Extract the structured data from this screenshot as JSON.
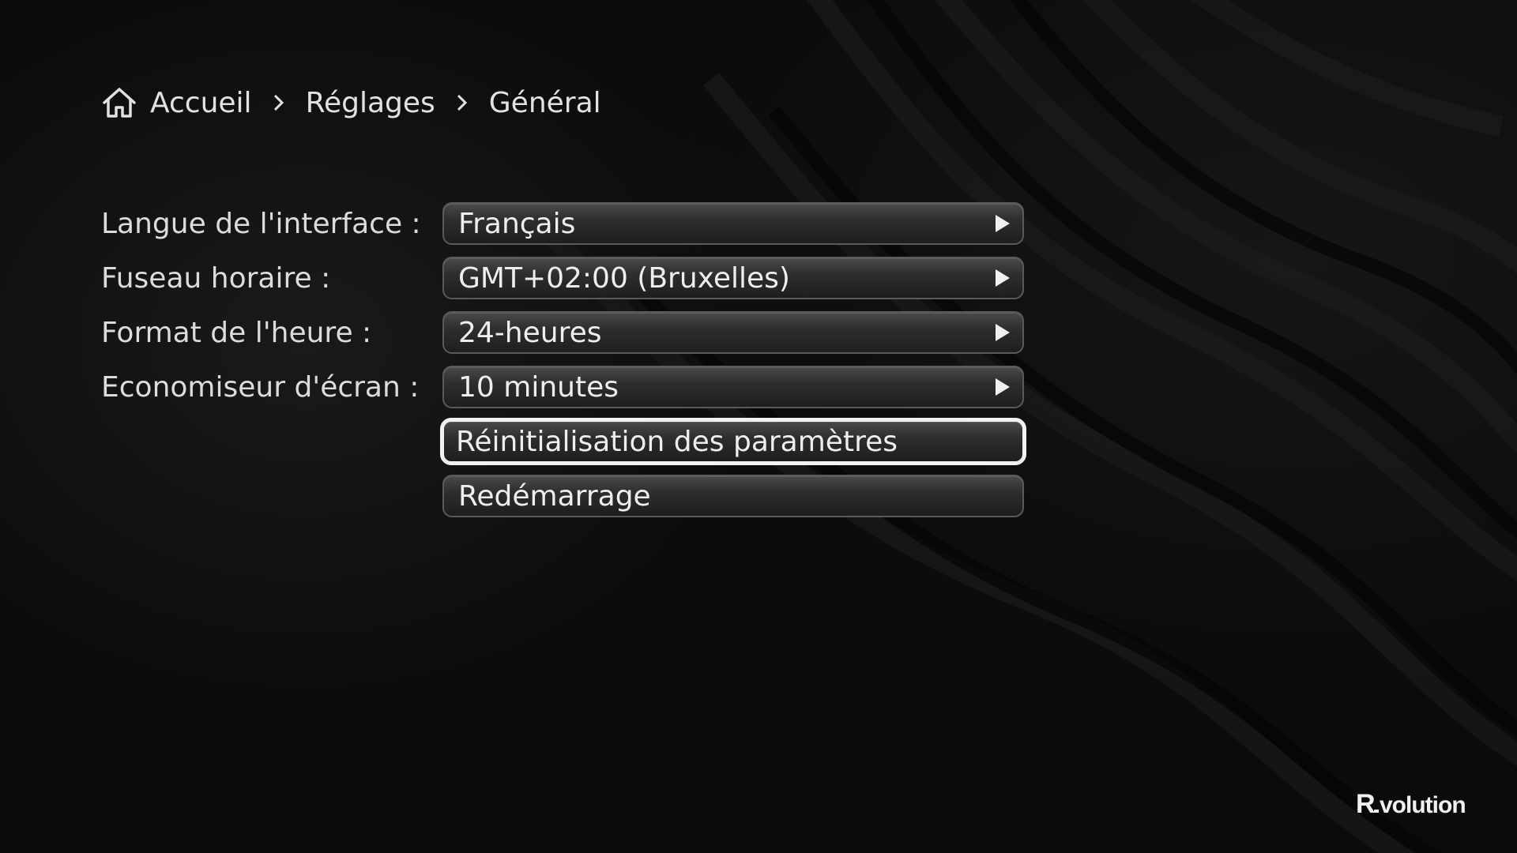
{
  "breadcrumb": {
    "home_icon": "home-icon",
    "separator_icon": "chevron-right-icon",
    "items": [
      "Accueil",
      "Réglages",
      "Général"
    ]
  },
  "settings": {
    "rows": [
      {
        "label": "Langue de l'interface :",
        "value": "Français",
        "icon": "play-arrow-icon"
      },
      {
        "label": "Fuseau horaire :",
        "value": "GMT+02:00 (Bruxelles)",
        "icon": "play-arrow-icon"
      },
      {
        "label": "Format de l'heure :",
        "value": "24-heures",
        "icon": "play-arrow-icon"
      },
      {
        "label": "Economiseur d'écran :",
        "value": "10 minutes",
        "icon": "play-arrow-icon"
      }
    ],
    "actions": [
      {
        "label": "Réinitialisation des paramètres",
        "focused": true
      },
      {
        "label": "Redémarrage",
        "focused": false
      }
    ]
  },
  "brand": {
    "logo_text": "R_volution"
  },
  "colors": {
    "background": "#0b0b0b",
    "text": "#e6e6e6",
    "focus_border": "#f2f2f2"
  }
}
